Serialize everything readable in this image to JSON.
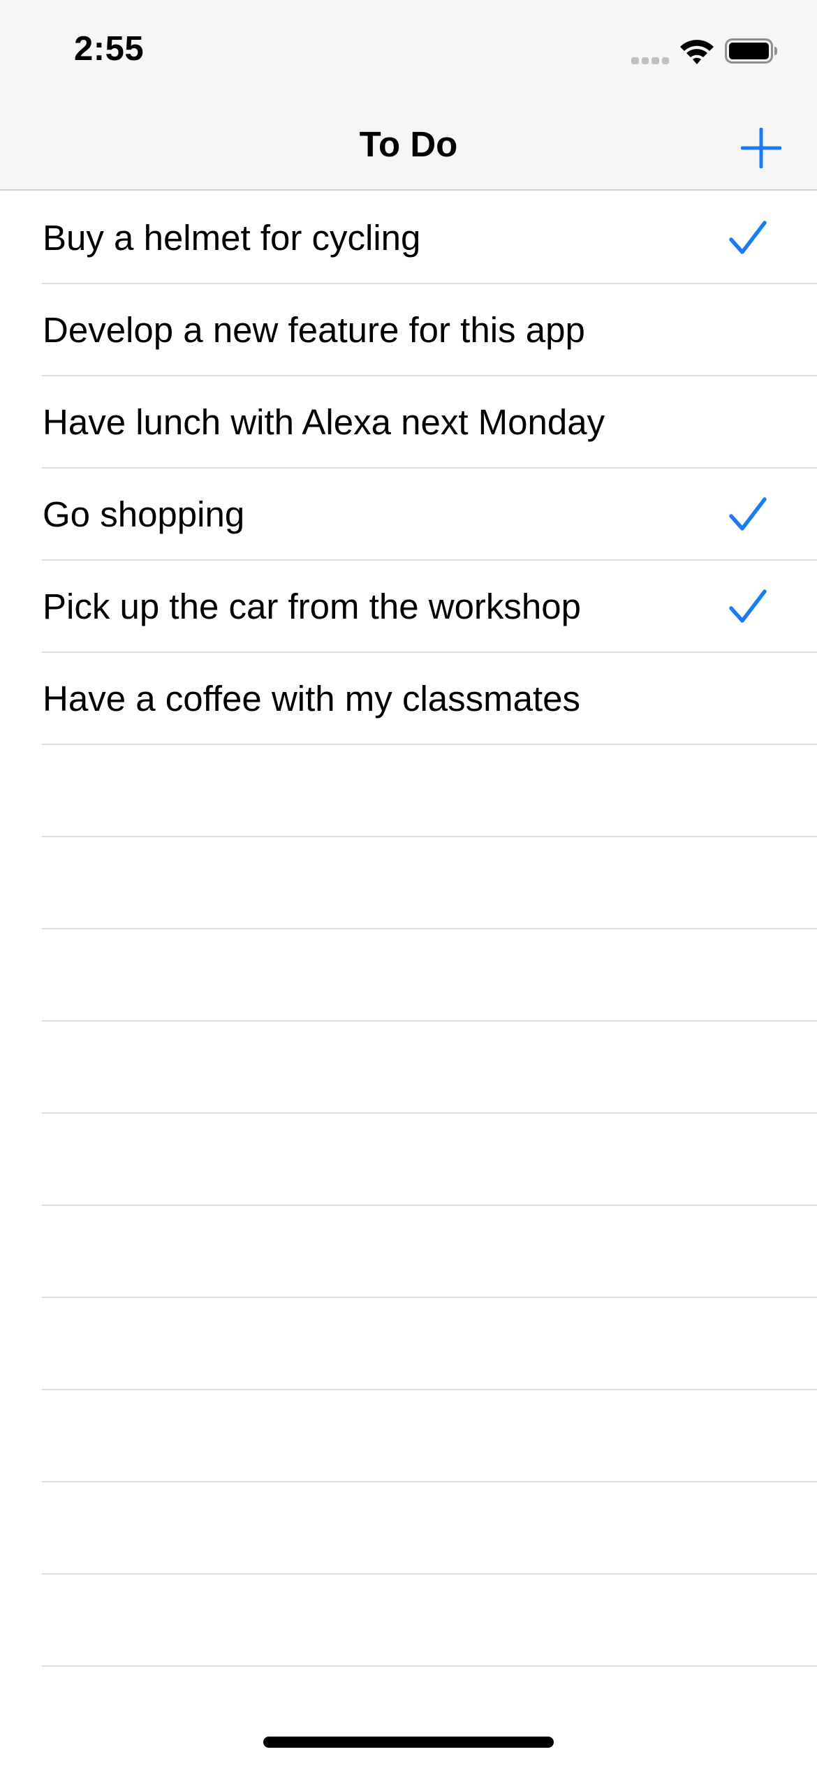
{
  "status_bar": {
    "time": "2:55",
    "icons": [
      "signal-icon",
      "wifi-icon",
      "battery-icon"
    ]
  },
  "nav": {
    "title": "To Do",
    "add_icon": "plus-icon"
  },
  "colors": {
    "accent": "#1a7cf5",
    "bar_background": "#f6f6f6",
    "separator": "#dcdce0"
  },
  "todos": [
    {
      "text": "Buy a helmet for cycling",
      "done": true
    },
    {
      "text": "Develop a new feature for this app",
      "done": false
    },
    {
      "text": "Have lunch with Alexa next Monday",
      "done": false
    },
    {
      "text": "Go shopping",
      "done": true
    },
    {
      "text": "Pick up the car from the workshop",
      "done": true
    },
    {
      "text": "Have a coffee with my classmates",
      "done": false
    }
  ],
  "empty_row_count": 10
}
